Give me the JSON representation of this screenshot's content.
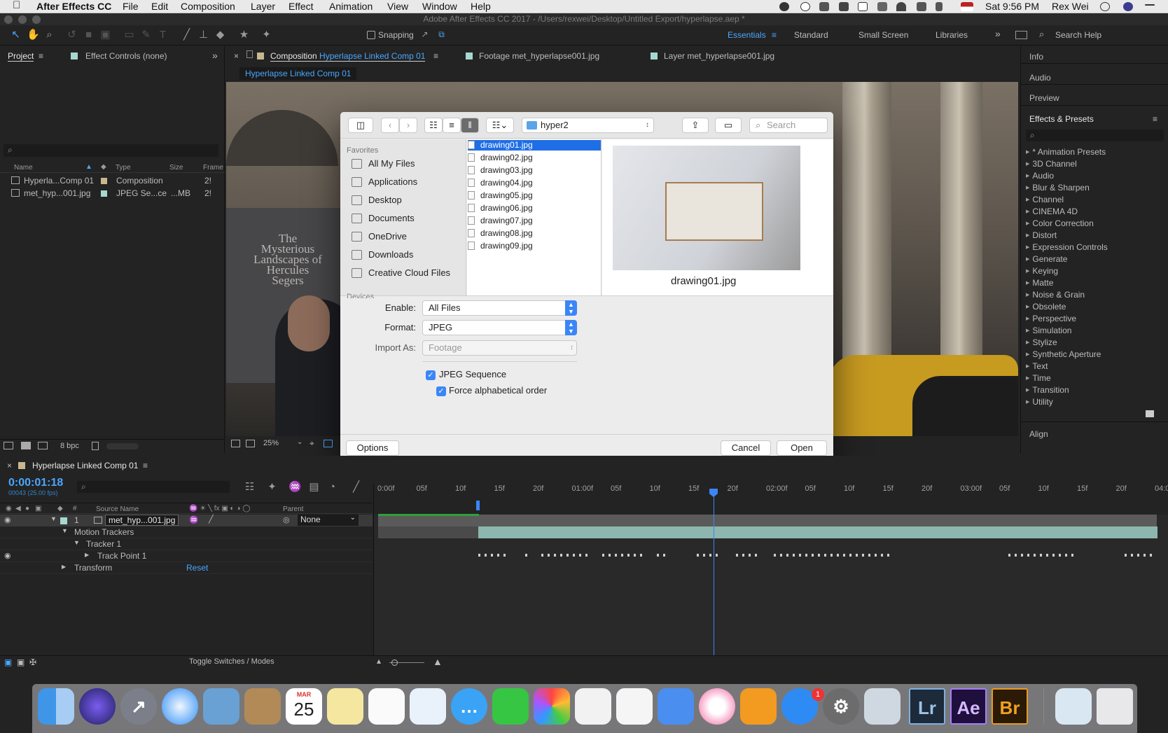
{
  "menubar": {
    "app": "After Effects CC",
    "items": [
      "File",
      "Edit",
      "Composition",
      "Layer",
      "Effect",
      "Animation",
      "View",
      "Window",
      "Help"
    ],
    "time": "Sat 9:56 PM",
    "user": "Rex Wei"
  },
  "window": {
    "title": "Adobe After Effects CC 2017 - /Users/rexwei/Desktop/Untitled Export/hyperlapse.aep *"
  },
  "toolbar": {
    "snapping": "Snapping",
    "workspaces": [
      "Essentials",
      "Standard",
      "Small Screen",
      "Libraries"
    ],
    "active_workspace": "Essentials",
    "search_help": "Search Help"
  },
  "project_panel": {
    "tab_project": "Project",
    "tab_effect_controls": "Effect Controls (none)",
    "columns": [
      "Name",
      "Type",
      "Size",
      "Frame"
    ],
    "items": [
      {
        "name": "Hyperla...Comp 01",
        "type": "Composition",
        "size": "",
        "frame": "2!",
        "color": "#c8b890"
      },
      {
        "name": "met_hyp...001.jpg",
        "type": "JPEG Se...ce",
        "size": "...MB",
        "frame": "2!",
        "color": "#a7d8d0"
      }
    ],
    "bpc": "8 bpc"
  },
  "composition_panel": {
    "tab_prefix": "Composition",
    "tab_name": "Hyperlapse Linked Comp 01",
    "footage_tab": "Footage met_hyperlapse001.jpg",
    "layer_tab": "Layer met_hyperlapse001.jpg",
    "subtab": "Hyperlapse Linked Comp 01",
    "zoom": "25%",
    "poster_title": "The Mysterious Landscapes of Hercules Segers"
  },
  "right_panels": {
    "tabs": [
      "Info",
      "Audio",
      "Preview"
    ],
    "effects_title": "Effects & Presets",
    "effects": [
      "* Animation Presets",
      "3D Channel",
      "Audio",
      "Blur & Sharpen",
      "Channel",
      "CINEMA 4D",
      "Color Correction",
      "Distort",
      "Expression Controls",
      "Generate",
      "Keying",
      "Matte",
      "Noise & Grain",
      "Obsolete",
      "Perspective",
      "Simulation",
      "Stylize",
      "Synthetic Aperture",
      "Text",
      "Time",
      "Transition",
      "Utility"
    ],
    "align": "Align"
  },
  "dialog": {
    "location": "hyper2",
    "search_placeholder": "Search",
    "favorites_header": "Favorites",
    "favorites": [
      "All My Files",
      "Applications",
      "Desktop",
      "Documents",
      "OneDrive",
      "Downloads",
      "Creative Cloud Files"
    ],
    "devices_header": "Devices",
    "files": [
      "drawing01.jpg",
      "drawing02.jpg",
      "drawing03.jpg",
      "drawing04.jpg",
      "drawing05.jpg",
      "drawing06.jpg",
      "drawing07.jpg",
      "drawing08.jpg",
      "drawing09.jpg"
    ],
    "selected_file": "drawing01.jpg",
    "preview_caption": "drawing01.jpg",
    "enable_label": "Enable:",
    "enable_value": "All Files",
    "format_label": "Format:",
    "format_value": "JPEG",
    "import_as_label": "Import As:",
    "import_as_value": "Footage",
    "jpeg_sequence": "JPEG Sequence",
    "force_alpha": "Force alphabetical order",
    "options": "Options",
    "cancel": "Cancel",
    "open": "Open"
  },
  "timeline": {
    "tab": "Hyperlapse Linked Comp 01",
    "timecode": "0:00:01:18",
    "frame_info": "00043 (25.00 fps)",
    "source_name_header": "Source Name",
    "parent_header": "Parent",
    "layer_number": "1",
    "layer_name": "met_hyp...001.jpg",
    "parent_value": "None",
    "rows": [
      "Motion Trackers",
      "Tracker 1",
      "Track Point 1",
      "Transform"
    ],
    "reset": "Reset",
    "ruler": [
      "0:00f",
      "05f",
      "10f",
      "15f",
      "20f",
      "01:00f",
      "05f",
      "10f",
      "15f",
      "20f",
      "02:00f",
      "05f",
      "10f",
      "15f",
      "20f",
      "03:00f",
      "05f",
      "10f",
      "15f",
      "20f",
      "04:0"
    ],
    "toggle": "Toggle Switches / Modes"
  },
  "dock": {
    "calendar_month": "MAR",
    "calendar_day": "25",
    "badge": "1",
    "lr": "Lr",
    "ae": "Ae",
    "br": "Br"
  }
}
